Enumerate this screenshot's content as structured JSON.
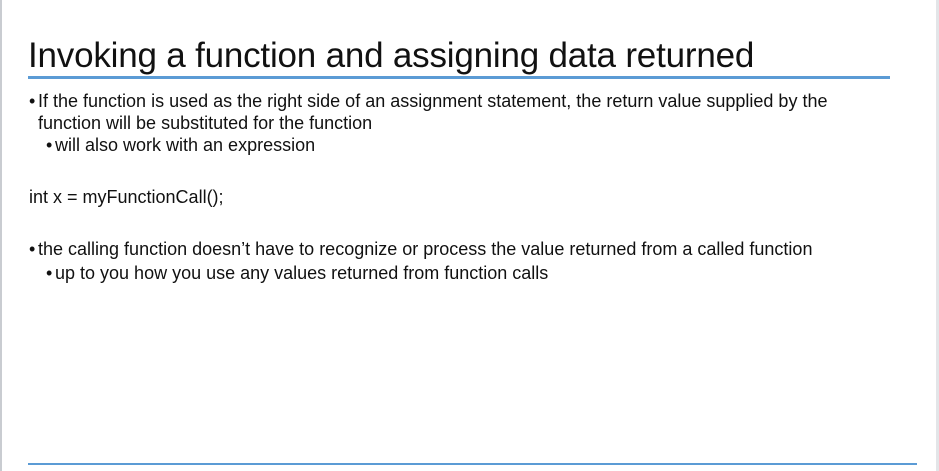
{
  "slide": {
    "title": "Invoking a function and assigning data returned",
    "bullet_glyph": "•",
    "bullets": [
      {
        "line1": "If the function is used as the right side of an assignment statement, the return value supplied by the",
        "line2": "function will be substituted for the function",
        "sub": "will also work with an expression"
      },
      {
        "text": "the calling function doesn’t have to recognize or process the value returned from a called function",
        "sub": "up to you how you use any values returned from function calls"
      }
    ],
    "code": "int x = myFunctionCall();"
  },
  "colors": {
    "accent_rule": "#5b9bd5",
    "text": "#111111",
    "background": "#ffffff"
  }
}
